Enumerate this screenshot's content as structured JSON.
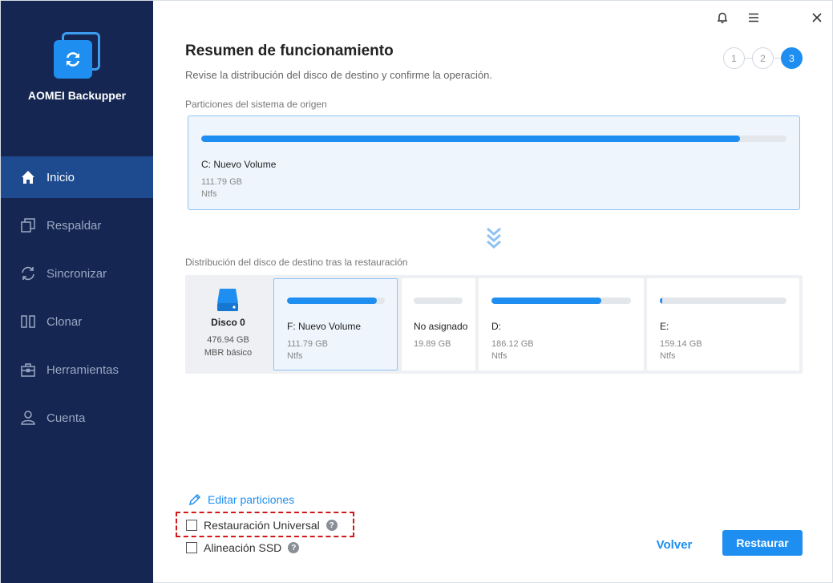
{
  "app": {
    "name": "AOMEI Backupper"
  },
  "sidebar": {
    "items": [
      {
        "label": "Inicio",
        "icon": "home-icon",
        "active": true
      },
      {
        "label": "Respaldar",
        "icon": "copy-icon",
        "active": false
      },
      {
        "label": "Sincronizar",
        "icon": "sync-icon",
        "active": false
      },
      {
        "label": "Clonar",
        "icon": "clone-icon",
        "active": false
      },
      {
        "label": "Herramientas",
        "icon": "toolbox-icon",
        "active": false
      },
      {
        "label": "Cuenta",
        "icon": "user-icon",
        "active": false
      }
    ]
  },
  "window_controls": [
    "bell-icon",
    "menu-icon",
    "close-icon"
  ],
  "header": {
    "title": "Resumen de funcionamiento",
    "subtitle": "Revise la distribución del disco de destino y confirme la operación.",
    "steps": [
      "1",
      "2",
      "3"
    ],
    "active_step": 3
  },
  "source": {
    "label": "Particiones del sistema de origen",
    "partition": {
      "name": "C: Nuevo Volume",
      "size": "111.79 GB",
      "fs": "Ntfs",
      "used_fraction": 0.92
    }
  },
  "destination": {
    "label": "Distribución del disco de destino tras la restauración",
    "disk": {
      "name": "Disco 0",
      "size": "476.94 GB",
      "type": "MBR básico"
    },
    "partitions": [
      {
        "name": "F: Nuevo Volume",
        "size": "111.79 GB",
        "fs": "Ntfs",
        "used_fraction": 0.92,
        "selected": true
      },
      {
        "name": "No asignado",
        "size": "19.89 GB",
        "fs": "",
        "used_fraction": 0,
        "selected": false
      },
      {
        "name": "D:",
        "size": "186.12 GB",
        "fs": "Ntfs",
        "used_fraction": 0.79,
        "selected": false
      },
      {
        "name": "E:",
        "size": "159.14 GB",
        "fs": "Ntfs",
        "used_fraction": 0.02,
        "selected": false
      }
    ]
  },
  "options": {
    "edit_partitions": "Editar particiones",
    "universal_restore": "Restauración Universal",
    "ssd_alignment": "Alineación SSD",
    "help_glyph": "?"
  },
  "buttons": {
    "back": "Volver",
    "restore": "Restaurar"
  },
  "colors": {
    "accent": "#1e8ef0",
    "sidebar": "#142651",
    "sidebar_active": "#1e4b8f",
    "highlight": "#d01818"
  }
}
